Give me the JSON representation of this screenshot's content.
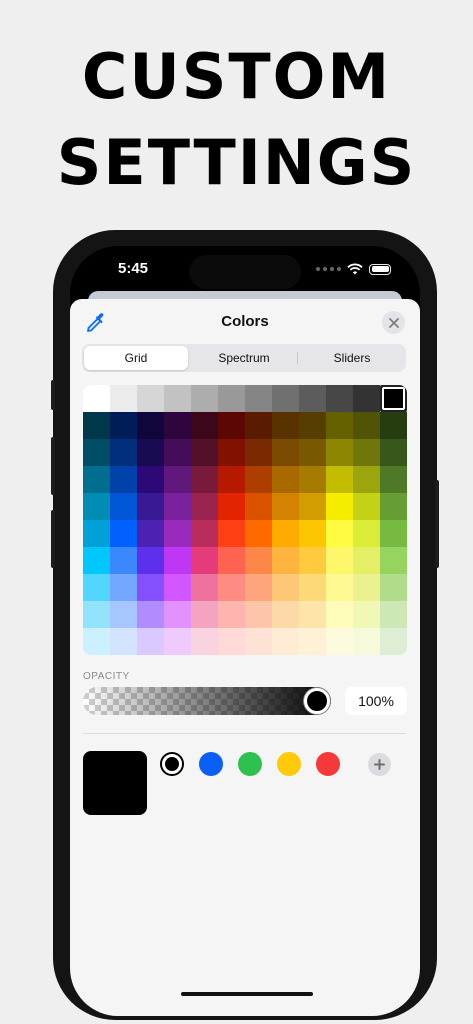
{
  "headline": {
    "line1": "CUSTOM",
    "line2": "SETTINGS"
  },
  "status_bar": {
    "time": "5:45"
  },
  "sheet": {
    "title": "Colors",
    "left_icon": "eyedropper-icon",
    "close_icon": "close-icon"
  },
  "tabs": [
    {
      "label": "Grid",
      "selected": true
    },
    {
      "label": "Spectrum",
      "selected": false
    },
    {
      "label": "Sliders",
      "selected": false
    }
  ],
  "grid": {
    "selected_color": "#000000",
    "rows": [
      [
        "#FFFFFF",
        "#EBEBEB",
        "#D6D6D6",
        "#C2C2C2",
        "#ADADAD",
        "#999999",
        "#858585",
        "#707070",
        "#5C5C5C",
        "#474747",
        "#333333",
        "#000000"
      ],
      [
        "#00374A",
        "#011D57",
        "#11053B",
        "#2E063D",
        "#3C071B",
        "#5C0701",
        "#5A1C00",
        "#583300",
        "#563D00",
        "#666100",
        "#4F5504",
        "#263E0F"
      ],
      [
        "#004D65",
        "#012F7B",
        "#1A0A52",
        "#450D59",
        "#551029",
        "#831100",
        "#7B2900",
        "#7A4A00",
        "#785800",
        "#8D8602",
        "#6F760A",
        "#38571A"
      ],
      [
        "#016E8F",
        "#0042A9",
        "#2C0977",
        "#61187C",
        "#791A3D",
        "#B51A00",
        "#AD3E00",
        "#A96800",
        "#A67B01",
        "#C4BC00",
        "#9BA50E",
        "#4E7A27"
      ],
      [
        "#008CB4",
        "#0056D6",
        "#371A94",
        "#7A219E",
        "#99244F",
        "#E22400",
        "#DA5100",
        "#D38301",
        "#D19D01",
        "#F5EC00",
        "#C3D117",
        "#669D34"
      ],
      [
        "#00A1D8",
        "#0061FE",
        "#4D22B2",
        "#982ABC",
        "#B92D5D",
        "#FF4015",
        "#FF6A00",
        "#FFAB01",
        "#FCC700",
        "#FEFB41",
        "#D9EC37",
        "#76BB40"
      ],
      [
        "#01C7FC",
        "#3A87FE",
        "#5E30EB",
        "#BE38F3",
        "#E63B7A",
        "#FE6250",
        "#FE8648",
        "#FEB43F",
        "#FECB3E",
        "#FFF76B",
        "#E4EF65",
        "#96D35F"
      ],
      [
        "#52D6FC",
        "#74A7FF",
        "#864FFE",
        "#D357FE",
        "#EE719E",
        "#FF8C82",
        "#FEA57D",
        "#FEC777",
        "#FED977",
        "#FFF994",
        "#EAF28F",
        "#B1DD8B"
      ],
      [
        "#93E3FC",
        "#A7C6FF",
        "#B18CFE",
        "#E292FE",
        "#F4A4C0",
        "#FFB5AF",
        "#FFC5AB",
        "#FED9A8",
        "#FDE4A8",
        "#FFFBB9",
        "#F1F7B7",
        "#CDE8B5"
      ],
      [
        "#CBF0FF",
        "#D3E2FF",
        "#D9C9FE",
        "#EFCAFE",
        "#F9D3E0",
        "#FFDAD8",
        "#FFE2D6",
        "#FEECD4",
        "#FEF1D5",
        "#FDFBDD",
        "#F6FADB",
        "#DEEED4"
      ]
    ]
  },
  "opacity": {
    "label": "OPACITY",
    "value_text": "100%",
    "value": 1.0
  },
  "current_color": "#000000",
  "swatches": [
    {
      "name": "black",
      "color": "#000000",
      "selected": true
    },
    {
      "name": "blue",
      "color": "#0A5FF5",
      "selected": false
    },
    {
      "name": "green",
      "color": "#2DC24F",
      "selected": false
    },
    {
      "name": "yellow",
      "color": "#FFCA0A",
      "selected": false
    },
    {
      "name": "red",
      "color": "#F5393B",
      "selected": false
    }
  ],
  "add_swatch_icon": "plus-icon"
}
